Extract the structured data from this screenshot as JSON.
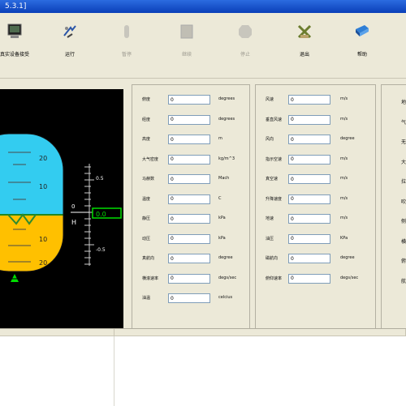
{
  "title": "5.3.1]",
  "toolbar": [
    {
      "id": "connect",
      "label": "真实设备接受",
      "enabled": true,
      "icon": "monitor-icon"
    },
    {
      "id": "run",
      "label": "运行",
      "enabled": true,
      "icon": "run-icon"
    },
    {
      "id": "pause",
      "label": "暂停",
      "enabled": false,
      "icon": "pause-icon"
    },
    {
      "id": "continue",
      "label": "继续",
      "enabled": false,
      "icon": "continue-icon"
    },
    {
      "id": "stop",
      "label": "停止",
      "enabled": false,
      "icon": "stop-icon"
    },
    {
      "id": "exit",
      "label": "退出",
      "enabled": true,
      "icon": "exit-icon"
    },
    {
      "id": "help",
      "label": "帮助",
      "enabled": true,
      "icon": "help-book-icon"
    }
  ],
  "attitude": {
    "sky_ticks": [
      "20",
      "10"
    ],
    "ground_ticks": [
      "10",
      "20"
    ],
    "scale_labels": [
      "0.5",
      "0",
      "-0.5"
    ],
    "h_label": "H",
    "height_value": "0.0",
    "colors": {
      "sky": "#33CCF0",
      "ground": "#FFC000",
      "needle": "#00DD00",
      "bg": "#000000"
    }
  },
  "panel1": [
    {
      "label": "俯度",
      "value": "0",
      "unit": "degrees"
    },
    {
      "label": "经度",
      "value": "0",
      "unit": "degrees"
    },
    {
      "label": "高度",
      "value": "0",
      "unit": "m"
    },
    {
      "label": "大气密度",
      "value": "0",
      "unit": "kg/m^3"
    },
    {
      "label": "马赫数",
      "value": "0",
      "unit": "Mach"
    },
    {
      "label": "温度",
      "value": "0",
      "unit": "C"
    },
    {
      "label": "静压",
      "value": "0",
      "unit": "kPa"
    },
    {
      "label": "动压",
      "value": "0",
      "unit": "kPa"
    },
    {
      "label": "真航向",
      "value": "0",
      "unit": "degree"
    },
    {
      "label": "横滚速率",
      "value": "0",
      "unit": "degs/sec"
    },
    {
      "label": "油温",
      "value": "0",
      "unit": "celcius"
    }
  ],
  "panel2": [
    {
      "label": "风速",
      "value": "0",
      "unit": "m/s"
    },
    {
      "label": "垂直风速",
      "value": "0",
      "unit": "m/s"
    },
    {
      "label": "风向",
      "value": "0",
      "unit": "degree"
    },
    {
      "label": "指示空速",
      "value": "0",
      "unit": "m/s"
    },
    {
      "label": "真空速",
      "value": "0",
      "unit": "m/s"
    },
    {
      "label": "升降速度",
      "value": "0",
      "unit": "m/s"
    },
    {
      "label": "地速",
      "value": "0",
      "unit": "m/s"
    },
    {
      "label": "油压",
      "value": "0",
      "unit": "KPa"
    },
    {
      "label": "磁航向",
      "value": "0",
      "unit": "degree"
    },
    {
      "label": "俯仰速率",
      "value": "0",
      "unit": "degs/sec"
    }
  ],
  "panel3": [
    "地",
    "气",
    "无",
    "大",
    "拉",
    "吹",
    "侧",
    "横",
    "俯",
    "航"
  ]
}
